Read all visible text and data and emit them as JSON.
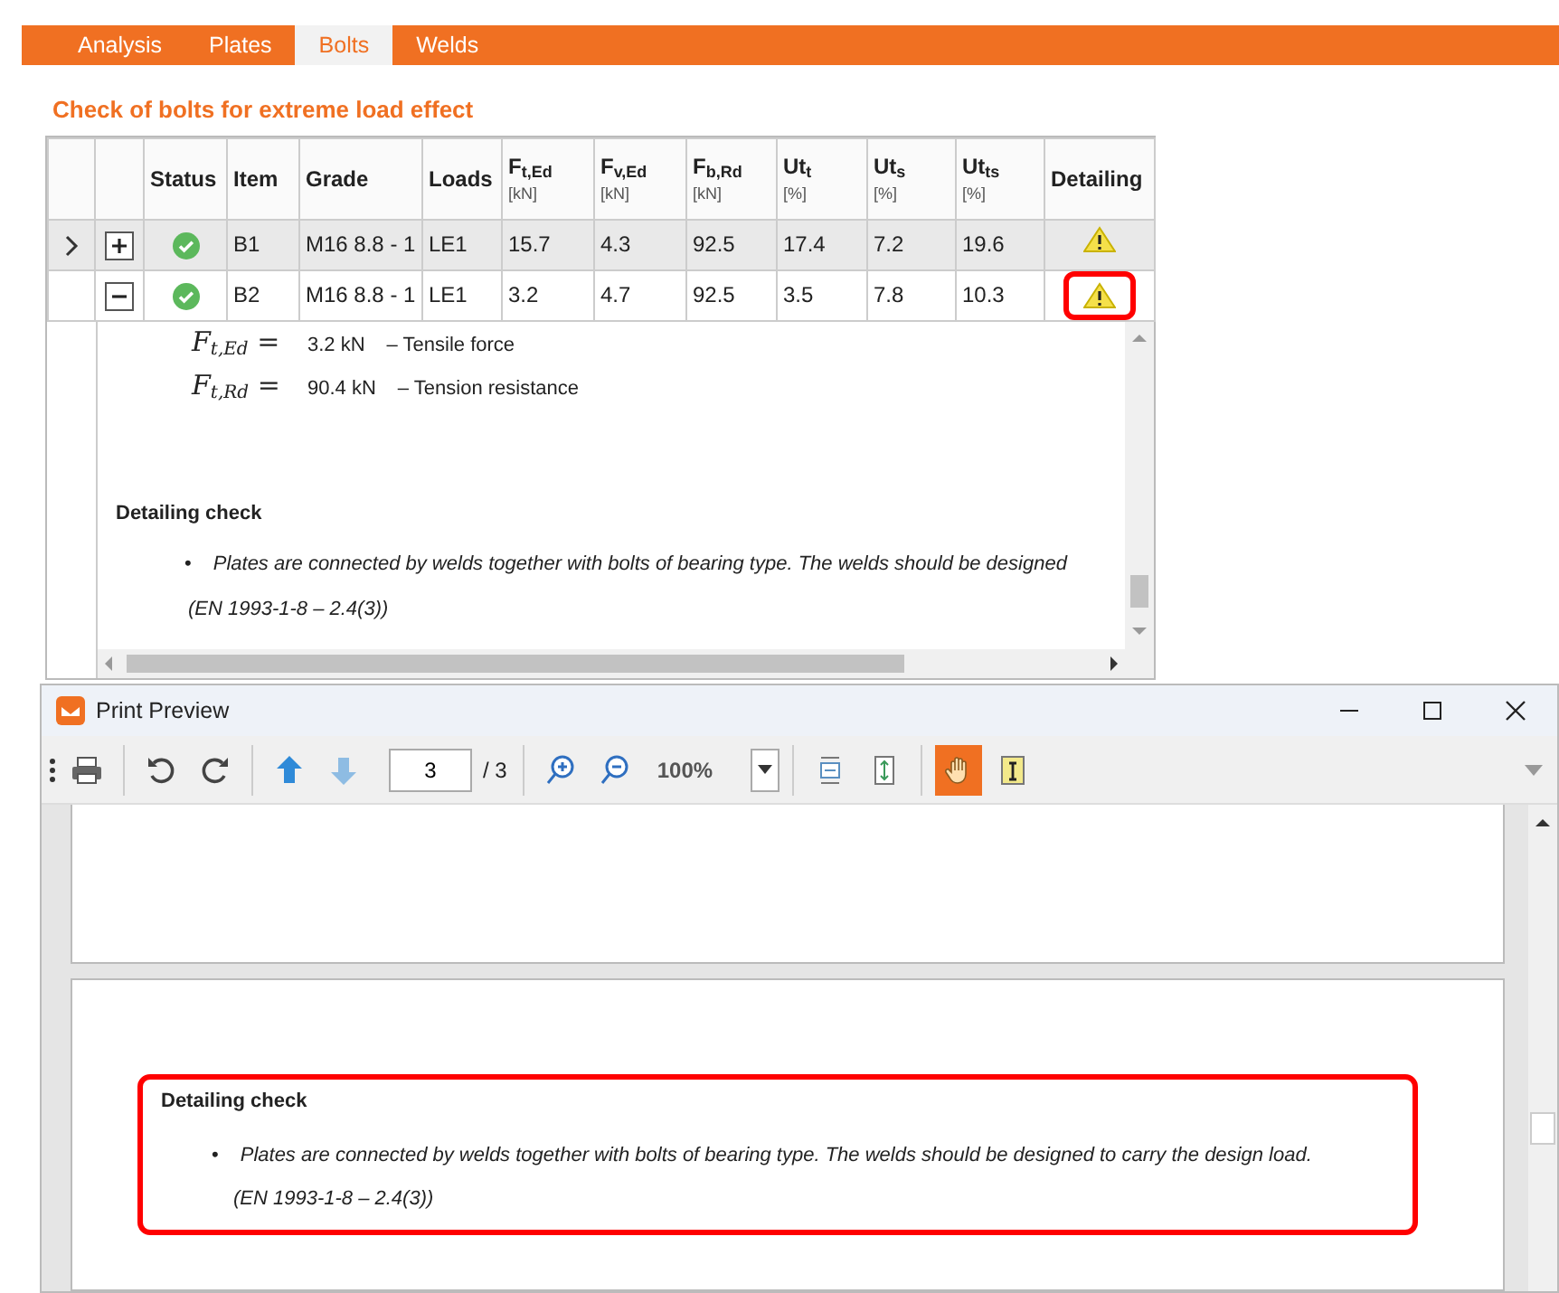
{
  "tabs": [
    {
      "label": "Analysis",
      "selected": false
    },
    {
      "label": "Plates",
      "selected": false
    },
    {
      "label": "Bolts",
      "selected": true
    },
    {
      "label": "Welds",
      "selected": false
    }
  ],
  "section_title": "Check of bolts for extreme load effect",
  "table": {
    "columns": [
      {
        "label": "Status"
      },
      {
        "label": "Item"
      },
      {
        "label": "Grade"
      },
      {
        "label": "Loads"
      },
      {
        "label": "F$_{t,Ed}$",
        "unit": "[kN]"
      },
      {
        "label": "F$_{v,Ed}$",
        "unit": "[kN]"
      },
      {
        "label": "F$_{b,Rd}$",
        "unit": "[kN]"
      },
      {
        "label": "Ut$_{t}$",
        "unit": "[%]"
      },
      {
        "label": "Ut$_{s}$",
        "unit": "[%]"
      },
      {
        "label": "Ut$_{ts}$",
        "unit": "[%]"
      },
      {
        "label": "Detailing"
      }
    ],
    "rows": [
      {
        "current": true,
        "selected": true,
        "expanded": false,
        "passed": true,
        "item": "B1",
        "grade": "M16 8.8 - 1",
        "loads": "LE1",
        "values": [
          "15.7",
          "4.3",
          "92.5",
          "17.4",
          "7.2",
          "19.6"
        ],
        "detailing_warning": true,
        "highlighted": false
      },
      {
        "current": false,
        "selected": false,
        "expanded": true,
        "passed": true,
        "item": "B2",
        "grade": "M16 8.8 - 1",
        "loads": "LE1",
        "values": [
          "3.2",
          "4.7",
          "92.5",
          "3.5",
          "7.8",
          "10.3"
        ],
        "detailing_warning": true,
        "highlighted": true
      }
    ]
  },
  "detail": {
    "formulas": [
      {
        "symbol": "*F*$_{t,Ed}$ =",
        "value": "3.2 kN",
        "description": "– Tensile force"
      },
      {
        "symbol": "*F*$_{t,Rd}$ =",
        "value": "90.4 kN",
        "description": "– Tension resistance"
      }
    ],
    "heading": "Detailing check",
    "bullets": [
      {
        "marker": "•",
        "text": "Plates are connected by welds together with bolts of bearing type. The welds should be designed"
      }
    ],
    "reference": "(EN 1993-1-8 – 2.4(3))"
  },
  "print_preview": {
    "title": "Print Preview",
    "toolbar": [
      {
        "kind": "print",
        "separator_before": false,
        "disabled": false,
        "selected": false
      },
      {
        "kind": "undo",
        "separator_before": true,
        "disabled": false,
        "selected": false
      },
      {
        "kind": "redo",
        "separator_before": false,
        "disabled": false,
        "selected": false
      },
      {
        "kind": "previous-page",
        "separator_before": true,
        "disabled": false,
        "selected": false
      },
      {
        "kind": "next-page",
        "separator_before": false,
        "disabled": true,
        "selected": false
      },
      {
        "kind": "page-field",
        "text": "3"
      },
      {
        "kind": "page-total",
        "text": "/ 3"
      },
      {
        "kind": "zoom-in",
        "separator_before": true,
        "disabled": false,
        "selected": false
      },
      {
        "kind": "zoom-out",
        "separator_before": false,
        "disabled": false,
        "selected": false
      },
      {
        "kind": "zoom-field",
        "text": "100%"
      },
      {
        "kind": "fit-width",
        "separator_before": true,
        "disabled": false,
        "selected": false
      },
      {
        "kind": "fit-page",
        "separator_before": false,
        "disabled": false,
        "selected": false
      },
      {
        "kind": "hand",
        "separator_before": true,
        "disabled": false,
        "selected": true
      },
      {
        "kind": "select-text",
        "separator_before": false,
        "disabled": false,
        "selected": false
      }
    ],
    "report": {
      "heading": "Detailing check",
      "bullets": [
        {
          "marker": "•",
          "text": "Plates are connected by welds together with bolts of bearing type. The welds should be designed to carry the design load."
        }
      ],
      "reference": "(EN 1993-1-8 – 2.4(3))",
      "highlighted": true
    }
  }
}
